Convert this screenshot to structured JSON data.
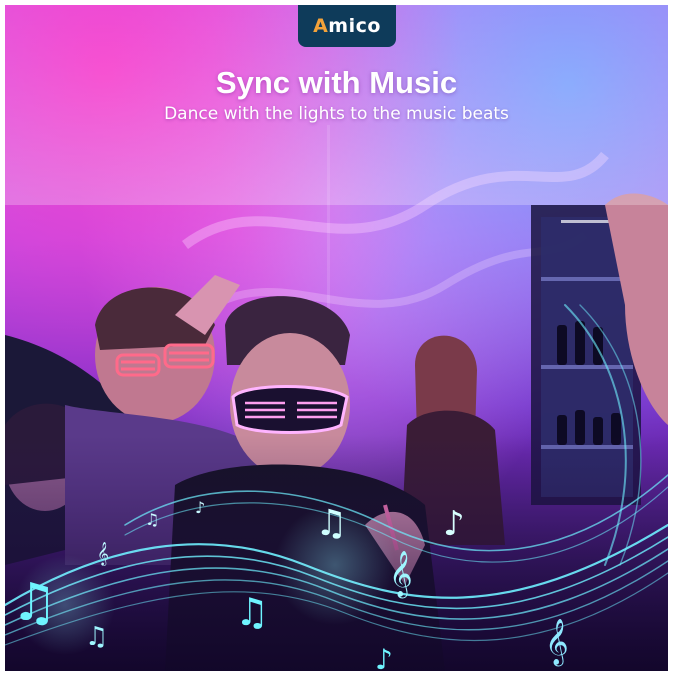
{
  "brand": {
    "logo_initial": "A",
    "logo_rest": "mico",
    "tab_color": "#0e3b5a",
    "accent": "#f2a23a"
  },
  "headline": "Sync with Music",
  "subline": "Dance with the lights to the music beats",
  "palette": {
    "magenta": "#e04ad8",
    "violet": "#a24ee6",
    "cyan": "#5fe8ff",
    "deep": "#1c0d3a"
  },
  "decor": {
    "icons": [
      "music-note-icon",
      "treble-clef-icon",
      "eighth-note-icon",
      "sound-wave-icon"
    ]
  }
}
